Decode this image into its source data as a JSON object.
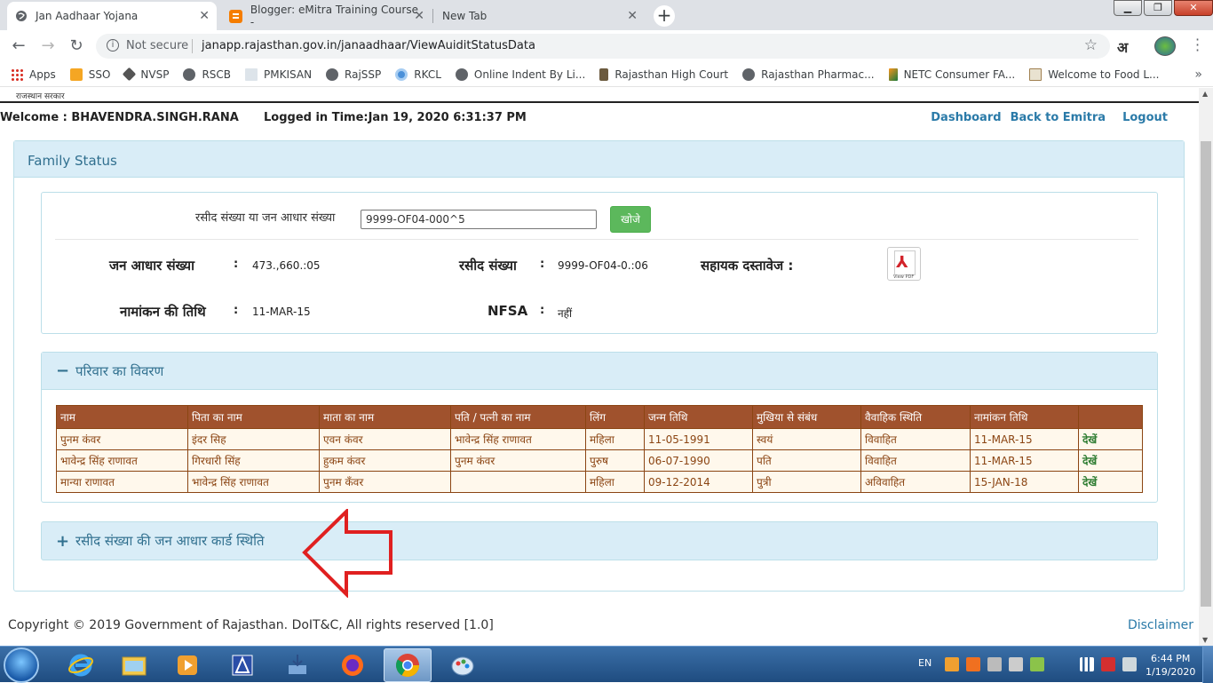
{
  "browser": {
    "tabs": [
      {
        "title": "Jan Aadhaar Yojana",
        "active": true
      },
      {
        "title": "Blogger: eMitra Training Course -",
        "active": false
      },
      {
        "title": "New Tab",
        "active": false
      }
    ],
    "new_tab_symbol": "+",
    "omnibox": {
      "security_text": "Not secure",
      "url": "janapp.rajasthan.gov.in/janaadhaar/ViewAuiditStatusData"
    },
    "ext_hindi": "अ",
    "bookmarks": [
      "Apps",
      "SSO",
      "NVSP",
      "RSCB",
      "PMKISAN",
      "RajSSP",
      "RKCL",
      "Online Indent By Li...",
      "Rajasthan High Court",
      "Rajasthan Pharmac...",
      "NETC Consumer FA...",
      "Welcome to Food L..."
    ],
    "bookmarks_more": "»"
  },
  "page": {
    "gov_small": "राजस्थान सरकार",
    "welcome": "Welcome : BHAVENDRA.SINGH.RANA",
    "logged_in": "Logged in Time:Jan 19, 2020 6:31:37 PM",
    "links": {
      "dashboard": "Dashboard",
      "back": "Back to Emitra",
      "logout": "Logout"
    },
    "panel_title": "Family Status",
    "search": {
      "label": "रसीद संख्या या जन आधार संख्या",
      "value": "9999-OF04-000^5",
      "button": "खोजे"
    },
    "fields": {
      "jan_aadhaar_label": "जन आधार संख्या",
      "jan_aadhaar_value": "473.,660.:05",
      "receipt_label": "रसीद संख्या",
      "receipt_value": "9999-OF04-0.:06",
      "docs_label": "सहायक दस्तावेज :",
      "enroll_label": "नामांकन की तिथि",
      "enroll_value": "11-MAR-15",
      "nfsa_label": "NFSA",
      "nfsa_value": "नहीं",
      "colon": ":",
      "pdf_caption": "View PDF"
    },
    "family": {
      "title": "परिवार का विवरण",
      "toggle": "−",
      "columns": [
        "नाम",
        "पिता का नाम",
        "माता का नाम",
        "पति / पत्नी का नाम",
        "लिंग",
        "जन्म तिथि",
        "मुखिया से संबंध",
        "वैवाहिक स्थिति",
        "नामांकन तिथि",
        ""
      ],
      "rows": [
        [
          "पुनम कंवर",
          "इंदर सिह",
          "एवन कंवर",
          "भावेन्द्र सिंह राणावत",
          "महिला",
          "11-05-1991",
          "स्वयं",
          "विवाहित",
          "11-MAR-15",
          "देखें"
        ],
        [
          "भावेन्द्र सिंह राणावत",
          "गिरधारी सिंह",
          "हुकम कंवर",
          "पुनम कंवर",
          "पुरुष",
          "06-07-1990",
          "पति",
          "विवाहित",
          "11-MAR-15",
          "देखें"
        ],
        [
          "मान्या राणावत",
          "भावेन्द्र सिंह राणावत",
          "पुनम कँवर",
          "",
          "महिला",
          "09-12-2014",
          "पुत्री",
          "अविवाहित",
          "15-JAN-18",
          "देखें"
        ]
      ]
    },
    "receipt_section": {
      "toggle": "+",
      "title": "रसीद संख्या की जन आधार कार्ड स्थिति"
    },
    "footer": {
      "copyright": "Copyright © 2019 Government of Rajasthan. DoIT&C, All rights reserved [1.0]",
      "disclaimer": "Disclaimer"
    }
  },
  "taskbar": {
    "lang": "EN",
    "time": "6:44 PM",
    "date": "1/19/2020"
  },
  "colors": {
    "header_brown": "#a0522d",
    "panel_blue": "#d9edf7",
    "link_blue": "#2a7aa8",
    "annotation_red": "#e02020"
  }
}
